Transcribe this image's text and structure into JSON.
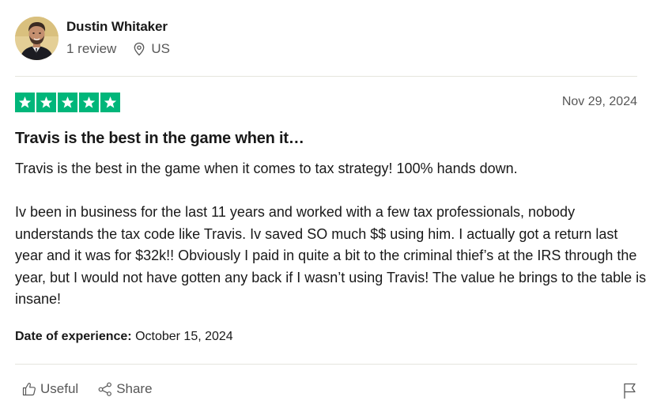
{
  "consumer": {
    "name": "Dustin Whitaker",
    "reviews": "1 review",
    "location": "US",
    "avatar_icon": "user-photo"
  },
  "review": {
    "rating": 5,
    "rating_max": 5,
    "star_color": "#00b67a",
    "date": "Nov 29, 2024",
    "title": "Travis is the best in the game when it…",
    "paragraphs": [
      "Travis is the best in the game when it comes to tax strategy! 100% hands down.",
      "Iv been in business for the last 11 years and worked with a few tax professionals, nobody understands the tax code like Travis. Iv saved SO much $$ using him. I actually got a return last year and it was for $32k!! Obviously I paid in quite a bit to the criminal thief’s at the IRS through the year, but I would not have gotten any back if I wasn’t using Travis! The value he brings to the table is insane!"
    ],
    "experience_label": "Date of experience:",
    "experience_date": "October 15, 2024"
  },
  "actions": {
    "useful_label": "Useful",
    "share_label": "Share",
    "useful_icon": "thumbs-up-icon",
    "share_icon": "share-icon",
    "report_icon": "flag-icon"
  }
}
